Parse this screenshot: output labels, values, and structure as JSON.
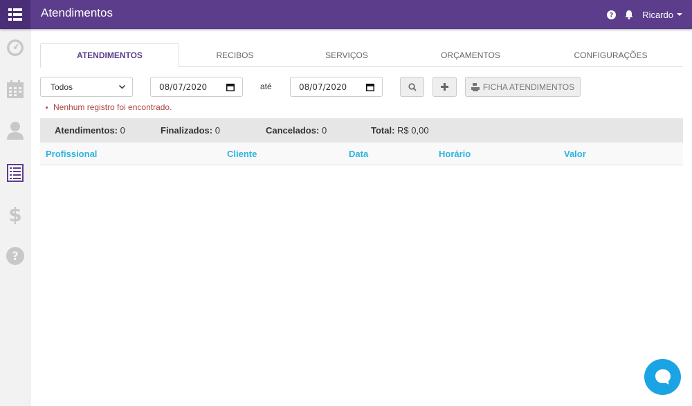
{
  "header": {
    "title": "Atendimentos",
    "user": "Ricardo",
    "brand_color": "#5b3d8c",
    "icons": [
      "grid-menu-icon",
      "help-icon",
      "bell-icon",
      "caret-down-icon"
    ]
  },
  "sidebar": {
    "items": [
      {
        "icon": "dashboard-icon"
      },
      {
        "icon": "calendar-icon"
      },
      {
        "icon": "user-icon"
      },
      {
        "icon": "list-icon",
        "active": true
      },
      {
        "icon": "dollar-icon"
      },
      {
        "icon": "help-circle-icon"
      }
    ]
  },
  "tabs": [
    {
      "label": "ATENDIMENTOS",
      "active": true
    },
    {
      "label": "RECIBOS"
    },
    {
      "label": "SERVIÇOS"
    },
    {
      "label": "ORÇAMENTOS"
    },
    {
      "label": "CONFIGURAÇÕES"
    }
  ],
  "filters": {
    "select_value": "Todos",
    "date_from": "08/07/2020",
    "separator": "até",
    "date_to": "08/07/2020",
    "ficha_label": "FICHA ATENDIMENTOS"
  },
  "error_message": "Nenhum registro foi encontrado.",
  "summary": {
    "atendimentos_label": "Atendimentos:",
    "atendimentos_value": "0",
    "finalizados_label": "Finalizados:",
    "finalizados_value": "0",
    "cancelados_label": "Cancelados:",
    "cancelados_value": "0",
    "total_label": "Total:",
    "total_value": "R$ 0,00"
  },
  "table": {
    "columns": [
      "Profissional",
      "Cliente",
      "Data",
      "Horário",
      "Valor"
    ],
    "rows": []
  },
  "colors": {
    "accent": "#5b3d8c",
    "link": "#2bb3e0",
    "error": "#a94442",
    "chat": "#1ba4e4"
  }
}
